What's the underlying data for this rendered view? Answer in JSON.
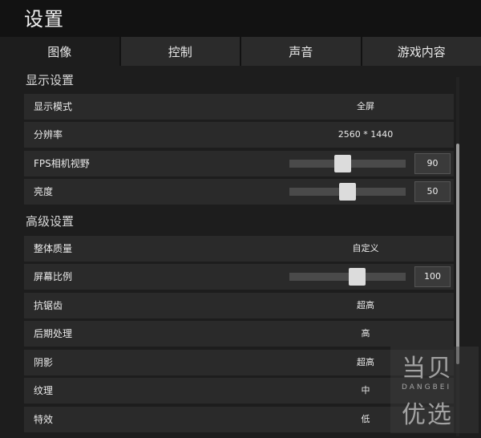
{
  "window": {
    "title": "设置"
  },
  "tabs": [
    "图像",
    "控制",
    "声音",
    "游戏内容"
  ],
  "active_tab": "图像",
  "sections": {
    "display": "显示设置",
    "advanced": "高级设置"
  },
  "rows": [
    {
      "label": "显示模式",
      "value": "全屏"
    },
    {
      "label": "分辨率",
      "value": "2560 * 1440"
    },
    {
      "label": "FPS相机视野",
      "number": "90",
      "level": 0.45
    },
    {
      "label": "亮度",
      "number": "50",
      "level": 0.5
    },
    {
      "label": "整体质量",
      "value": "自定义"
    },
    {
      "label": "屏幕比例",
      "number": "100",
      "level": 0.6
    },
    {
      "label": "抗锯齿",
      "value": "超高"
    },
    {
      "label": "后期处理",
      "value": "高"
    },
    {
      "label": "阴影",
      "value": "超高"
    },
    {
      "label": "纹理",
      "value": "中"
    },
    {
      "label": "特效",
      "value": "低"
    }
  ],
  "watermark": {
    "top": "当贝",
    "middle": "DANGBEI",
    "bottom": "优选"
  }
}
